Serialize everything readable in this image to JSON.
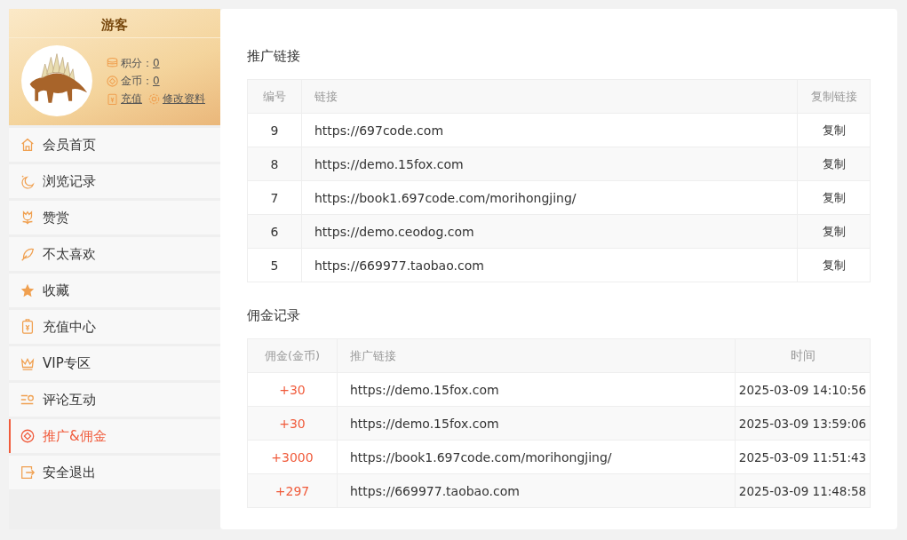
{
  "profile": {
    "name": "游客",
    "points_label": "积分：",
    "points": "0",
    "coins_label": "金币：",
    "coins": "0",
    "recharge": "充值",
    "edit_profile": "修改资料"
  },
  "menu": [
    {
      "label": "会员首页",
      "selected": false
    },
    {
      "label": "浏览记录",
      "selected": false
    },
    {
      "label": "赞赏",
      "selected": false
    },
    {
      "label": "不太喜欢",
      "selected": false
    },
    {
      "label": "收藏",
      "selected": false
    },
    {
      "label": "充值中心",
      "selected": false
    },
    {
      "label": "VIP专区",
      "selected": false
    },
    {
      "label": "评论互动",
      "selected": false
    },
    {
      "label": "推广&佣金",
      "selected": true
    },
    {
      "label": "安全退出",
      "selected": false
    }
  ],
  "links": {
    "title": "推广链接",
    "columns": [
      "编号",
      "链接",
      "复制链接"
    ],
    "rows": [
      {
        "id": "9",
        "url": "https://697code.com",
        "action": "复制"
      },
      {
        "id": "8",
        "url": "https://demo.15fox.com",
        "action": "复制"
      },
      {
        "id": "7",
        "url": "https://book1.697code.com/morihongjing/",
        "action": "复制"
      },
      {
        "id": "6",
        "url": "https://demo.ceodog.com",
        "action": "复制"
      },
      {
        "id": "5",
        "url": "https://669977.taobao.com",
        "action": "复制"
      }
    ]
  },
  "commissions": {
    "title": "佣金记录",
    "columns": [
      "佣金(金币)",
      "推广链接",
      "时间"
    ],
    "rows": [
      {
        "amount": "+30",
        "url": "https://demo.15fox.com",
        "time": "2025-03-09 14:10:56"
      },
      {
        "amount": "+30",
        "url": "https://demo.15fox.com",
        "time": "2025-03-09 13:59:06"
      },
      {
        "amount": "+3000",
        "url": "https://book1.697code.com/morihongjing/",
        "time": "2025-03-09 11:51:43"
      },
      {
        "amount": "+297",
        "url": "https://669977.taobao.com",
        "time": "2025-03-09 11:48:58"
      }
    ]
  }
}
